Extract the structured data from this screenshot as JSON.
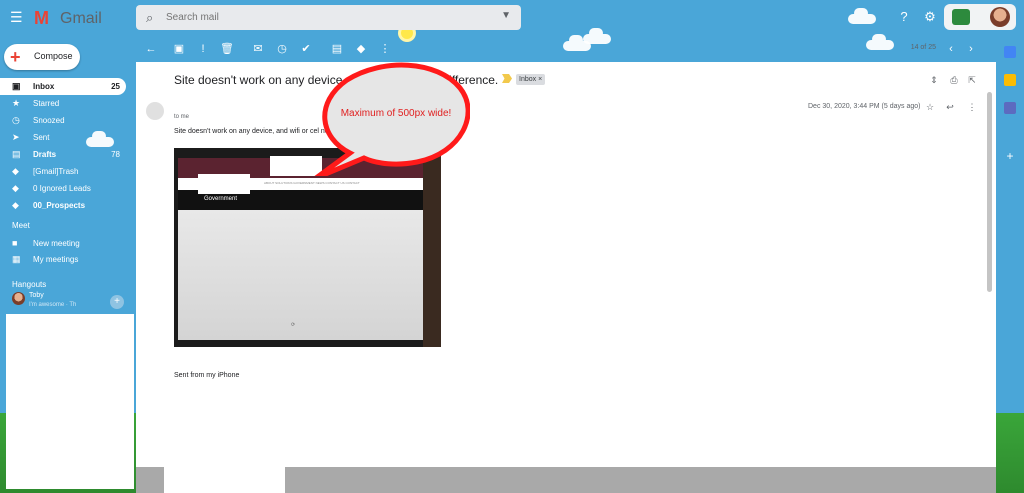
{
  "app": {
    "logo_text": "Gmail"
  },
  "search": {
    "placeholder": "Search mail"
  },
  "compose": {
    "label": "Compose"
  },
  "nav": {
    "items": [
      {
        "label": "Inbox",
        "count": "25"
      },
      {
        "label": "Starred",
        "count": ""
      },
      {
        "label": "Snoozed",
        "count": ""
      },
      {
        "label": "Sent",
        "count": ""
      },
      {
        "label": "Drafts",
        "count": "78"
      },
      {
        "label": "[Gmail]Trash",
        "count": ""
      },
      {
        "label": "0 Ignored Leads",
        "count": ""
      },
      {
        "label": "00_Prospects",
        "count": ""
      }
    ],
    "meet_heading": "Meet",
    "meet_items": [
      {
        "label": "New meeting"
      },
      {
        "label": "My meetings"
      }
    ],
    "hangouts_heading": "Hangouts",
    "hangouts_contact": {
      "name": "Toby",
      "status": "I'm awesome · Th"
    }
  },
  "toolbar": {
    "pager": "14 of 25"
  },
  "email": {
    "subject": "Site doesn't work on any device, and wifi or cel no difference.",
    "label_chip": "Inbox ×",
    "recipient": "to me",
    "timestamp": "Dec 30, 2020, 3:44 PM (5 days ago)",
    "body": "Site doesn't work on any device, and wifi or cel no difference. Something is screwed with th",
    "signature": "Sent from my iPhone"
  },
  "attachment": {
    "nav_text": "ABOUT   SOLUTIONS   GOVERNMENT   NEWS   CONTACT US   CONTACT",
    "banner_label": "Government"
  },
  "annotation": {
    "text": "Maximum of 500px wide!",
    "fill_color": "#e6e6e6",
    "stroke_color": "#ff1a1a",
    "text_color": "#e02020"
  }
}
